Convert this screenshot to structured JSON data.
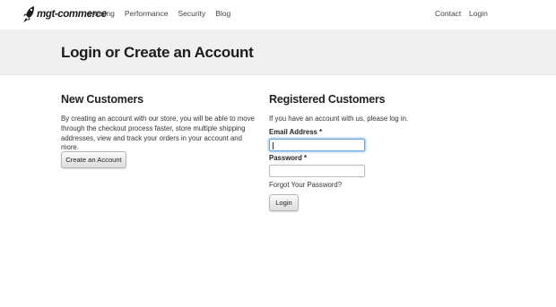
{
  "brand": {
    "logo_text": "mgt-commerce",
    "icon": "rocket-icon"
  },
  "nav": {
    "left": [
      "Hosting",
      "Performance",
      "Security",
      "Blog"
    ],
    "contact": "Contact",
    "login": "Login"
  },
  "page": {
    "title": "Login or Create an Account"
  },
  "new_customers": {
    "title": "New Customers",
    "text": "By creating an account with our store, you will be able to move through the checkout process faster, store multiple shipping addresses, view and track your orders in your account and more.",
    "button": "Create an Account"
  },
  "registered": {
    "title": "Registered Customers",
    "intro": "If you have an account with us, please log in.",
    "email_label": "Email Address",
    "password_label": "Password",
    "required_mark": "*",
    "email_value": "",
    "password_value": "",
    "forgot_link": "Forgot Your Password?",
    "login_button": "Login"
  },
  "colors": {
    "banner_bg": "#f0f0f0",
    "focus_ring": "#6aa5e3"
  }
}
